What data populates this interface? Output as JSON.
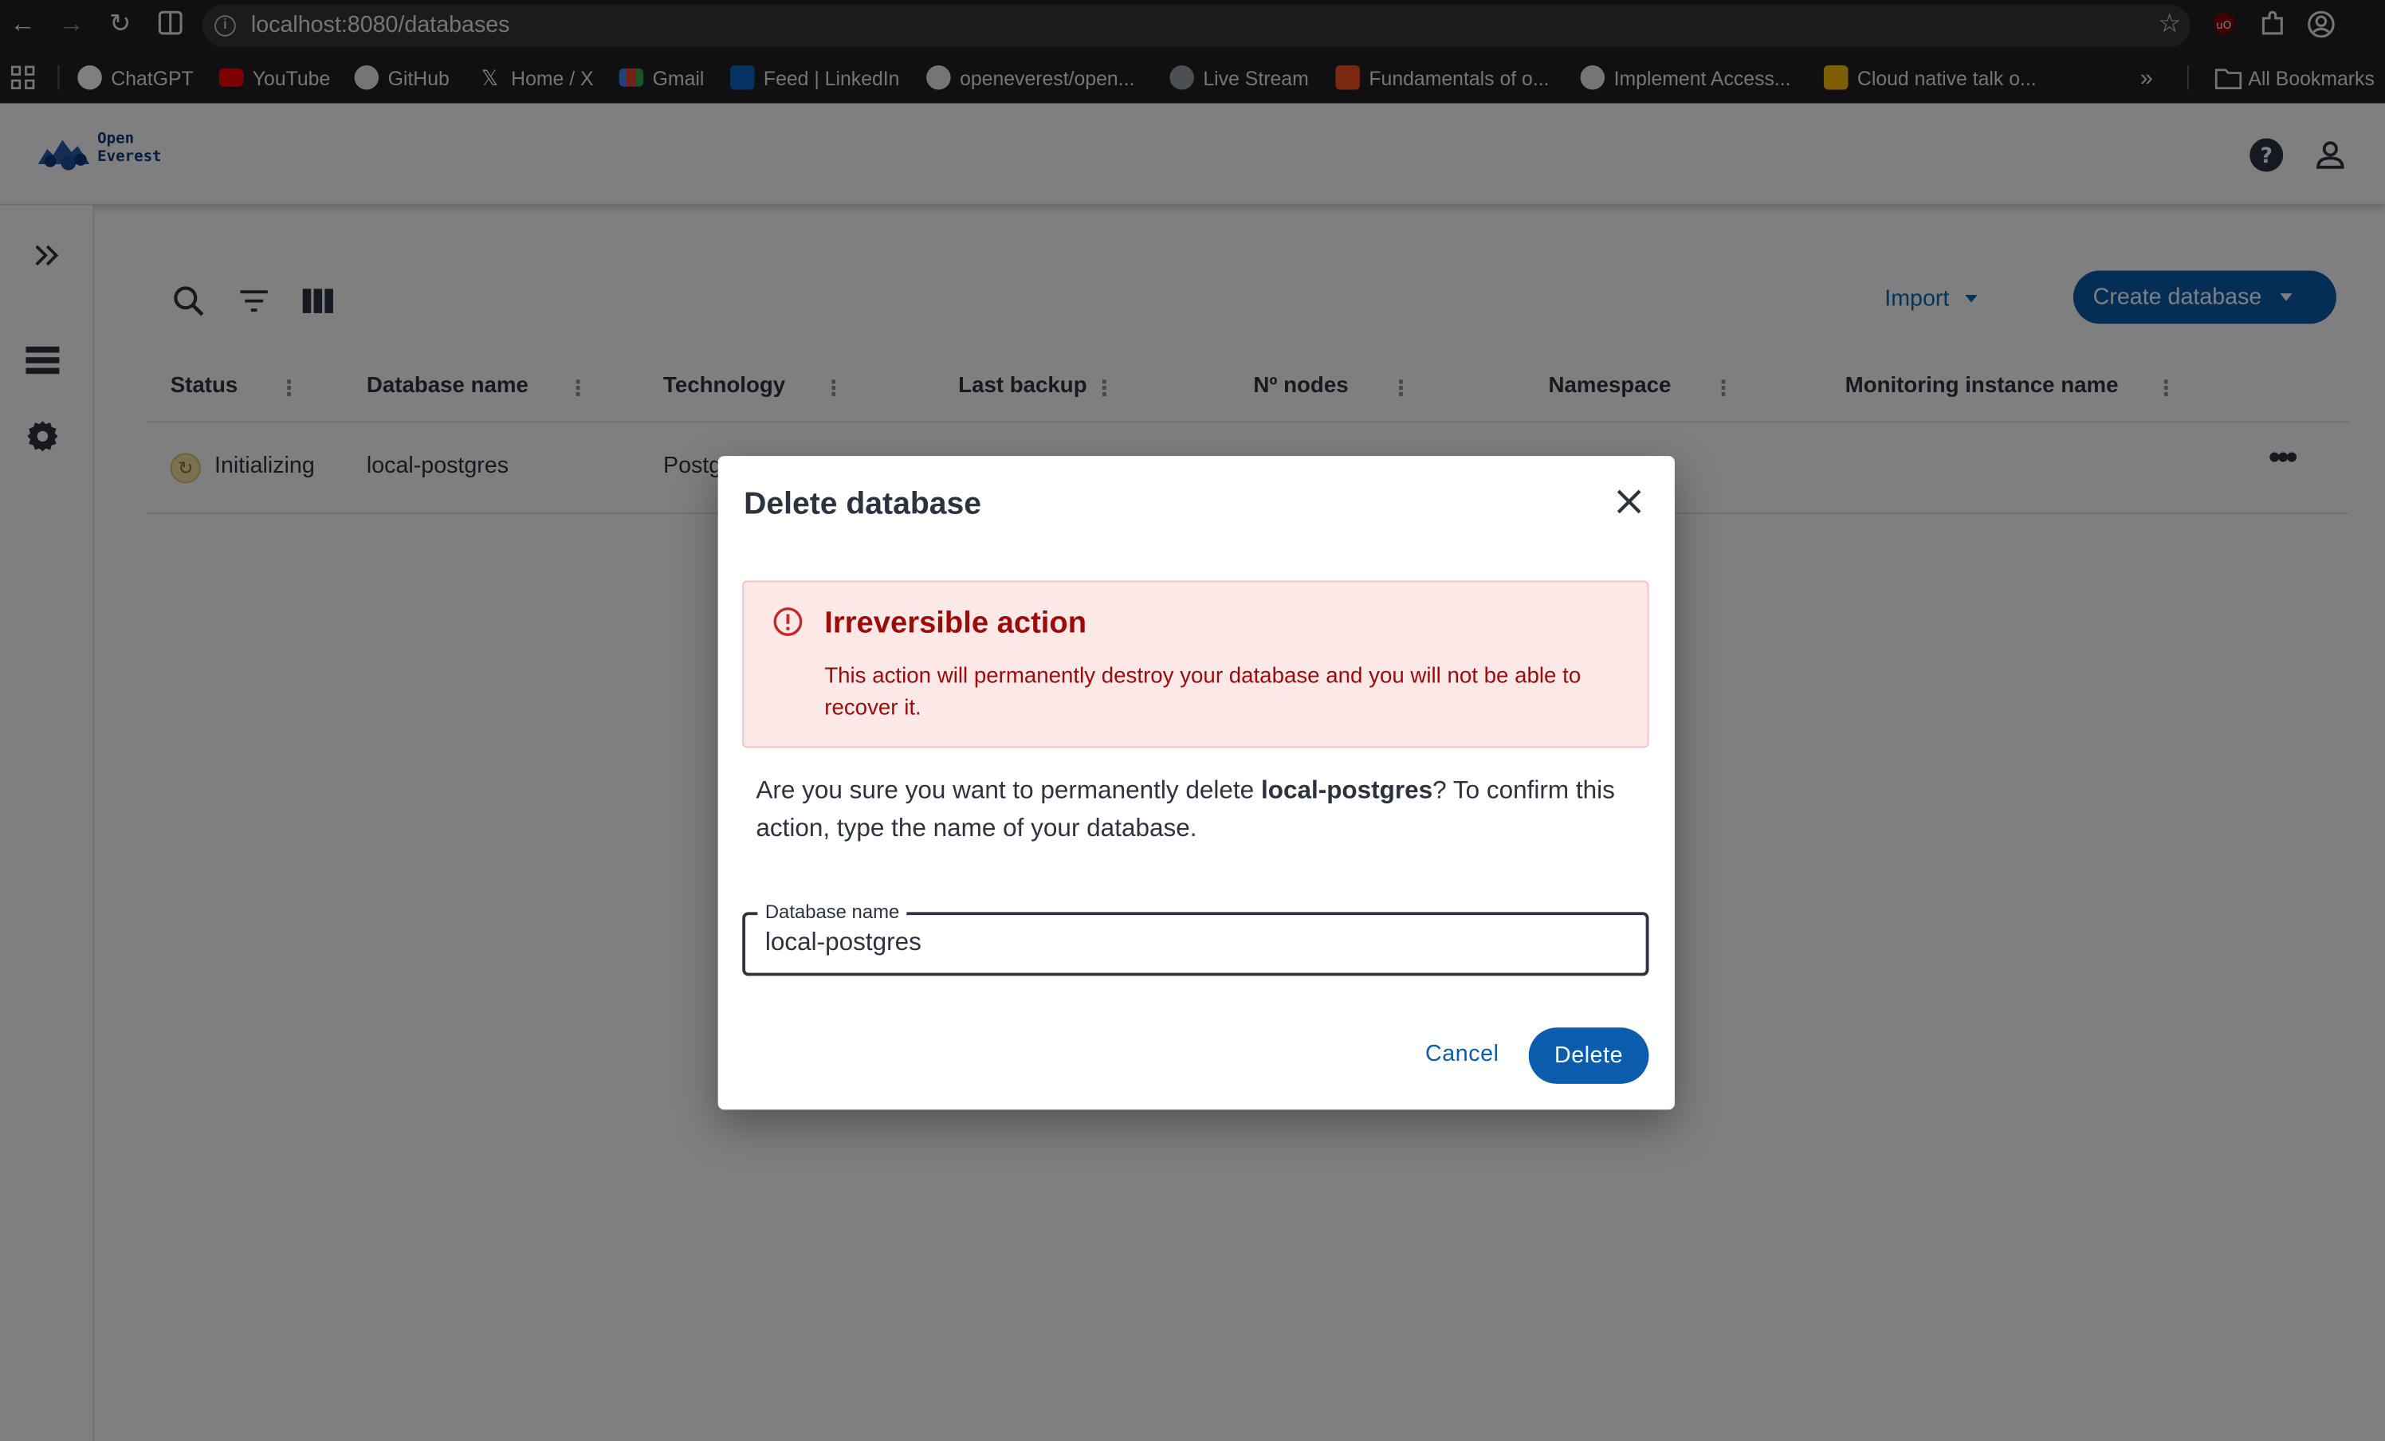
{
  "browser": {
    "url": "localhost:8080/databases",
    "bookmarks": [
      {
        "label": "ChatGPT",
        "icon": "chatgpt-icon"
      },
      {
        "label": "YouTube",
        "icon": "youtube-icon"
      },
      {
        "label": "GitHub",
        "icon": "github-icon"
      },
      {
        "label": "Home / X",
        "icon": "x-icon"
      },
      {
        "label": "Gmail",
        "icon": "gmail-icon"
      },
      {
        "label": "Feed | LinkedIn",
        "icon": "linkedin-icon"
      },
      {
        "label": "openeverest/open...",
        "icon": "github-icon"
      },
      {
        "label": "Live Stream",
        "icon": "globe-icon"
      },
      {
        "label": "Fundamentals of o...",
        "icon": "fire-icon"
      },
      {
        "label": "Implement Access...",
        "icon": "github-icon"
      },
      {
        "label": "Cloud native talk o...",
        "icon": "slides-icon"
      }
    ],
    "all_bookmarks": "All Bookmarks"
  },
  "app": {
    "logo": {
      "line1": "Open",
      "line2": "Everest"
    },
    "toolbar": {
      "import_label": "Import",
      "create_label": "Create database"
    },
    "table": {
      "columns": [
        "Status",
        "Database name",
        "Technology",
        "Last backup",
        "Nº nodes",
        "Namespace",
        "Monitoring instance name"
      ],
      "rows": [
        {
          "status": "Initializing",
          "name": "local-postgres",
          "technology": "Postgres"
        }
      ]
    }
  },
  "dialog": {
    "title": "Delete database",
    "alert_title": "Irreversible action",
    "alert_text": "This action will permanently destroy your database and you will not be able to recover it.",
    "confirm_prefix": "Are you sure you want to permanently delete ",
    "confirm_name": "local-postgres",
    "confirm_suffix": "? To confirm this action, type the name of your database.",
    "field_label": "Database name",
    "field_value": "local-postgres",
    "cancel_label": "Cancel",
    "delete_label": "Delete"
  },
  "colors": {
    "primary": "#0b5cad",
    "alert_bg": "#fde8e8",
    "alert_text": "#9c0a0a",
    "status_initializing": "#f3e2a3"
  }
}
